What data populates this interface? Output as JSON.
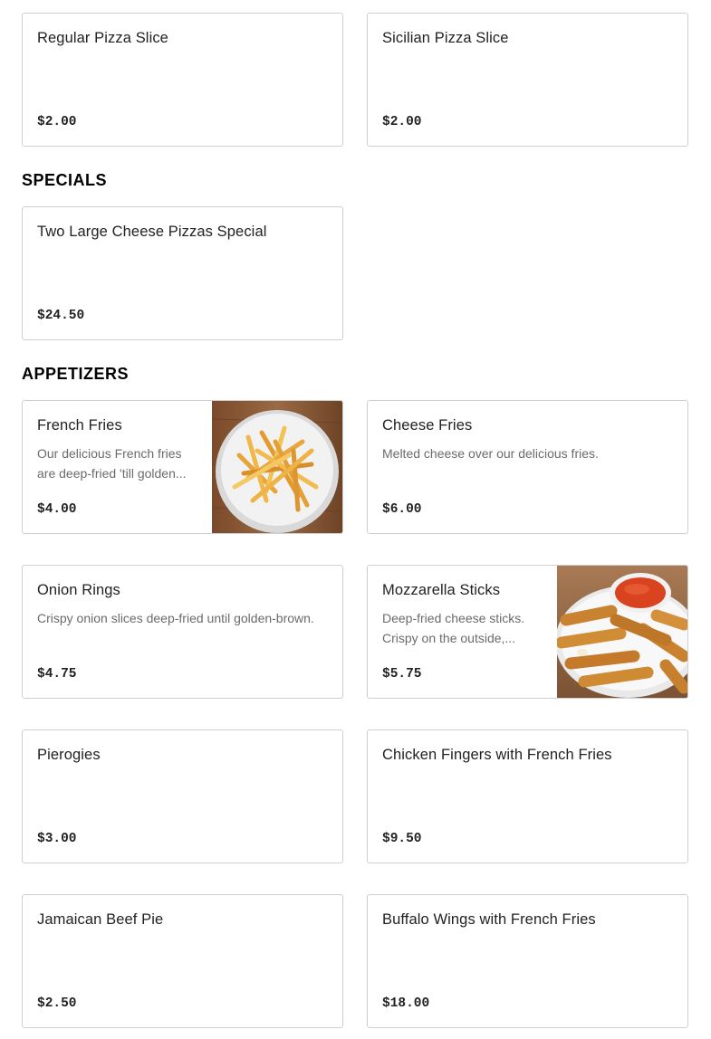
{
  "items_top": [
    {
      "name": "Regular Pizza Slice",
      "price": "$2.00"
    },
    {
      "name": "Sicilian Pizza Slice",
      "price": "$2.00"
    }
  ],
  "specials": {
    "title": "SPECIALS",
    "items": [
      {
        "name": "Two Large Cheese Pizzas Special",
        "price": "$24.50"
      }
    ]
  },
  "appetizers": {
    "title": "APPETIZERS",
    "items": [
      {
        "name": "French Fries",
        "description": "Our delicious French fries are deep-fried 'till golden...",
        "price": "$4.00",
        "image": "french-fries-photo"
      },
      {
        "name": "Cheese Fries",
        "description": "Melted cheese over our delicious fries.",
        "price": "$6.00"
      },
      {
        "name": "Onion Rings",
        "description": "Crispy onion slices deep-fried until golden-brown.",
        "price": "$4.75"
      },
      {
        "name": "Mozzarella Sticks",
        "description": "Deep-fried cheese sticks. Crispy on the outside,...",
        "price": "$5.75",
        "image": "mozzarella-sticks-photo"
      },
      {
        "name": "Pierogies",
        "price": "$3.00"
      },
      {
        "name": "Chicken Fingers with French Fries",
        "price": "$9.50"
      },
      {
        "name": "Jamaican Beef Pie",
        "price": "$2.50"
      },
      {
        "name": "Buffalo Wings with French Fries",
        "price": "$18.00"
      }
    ]
  }
}
